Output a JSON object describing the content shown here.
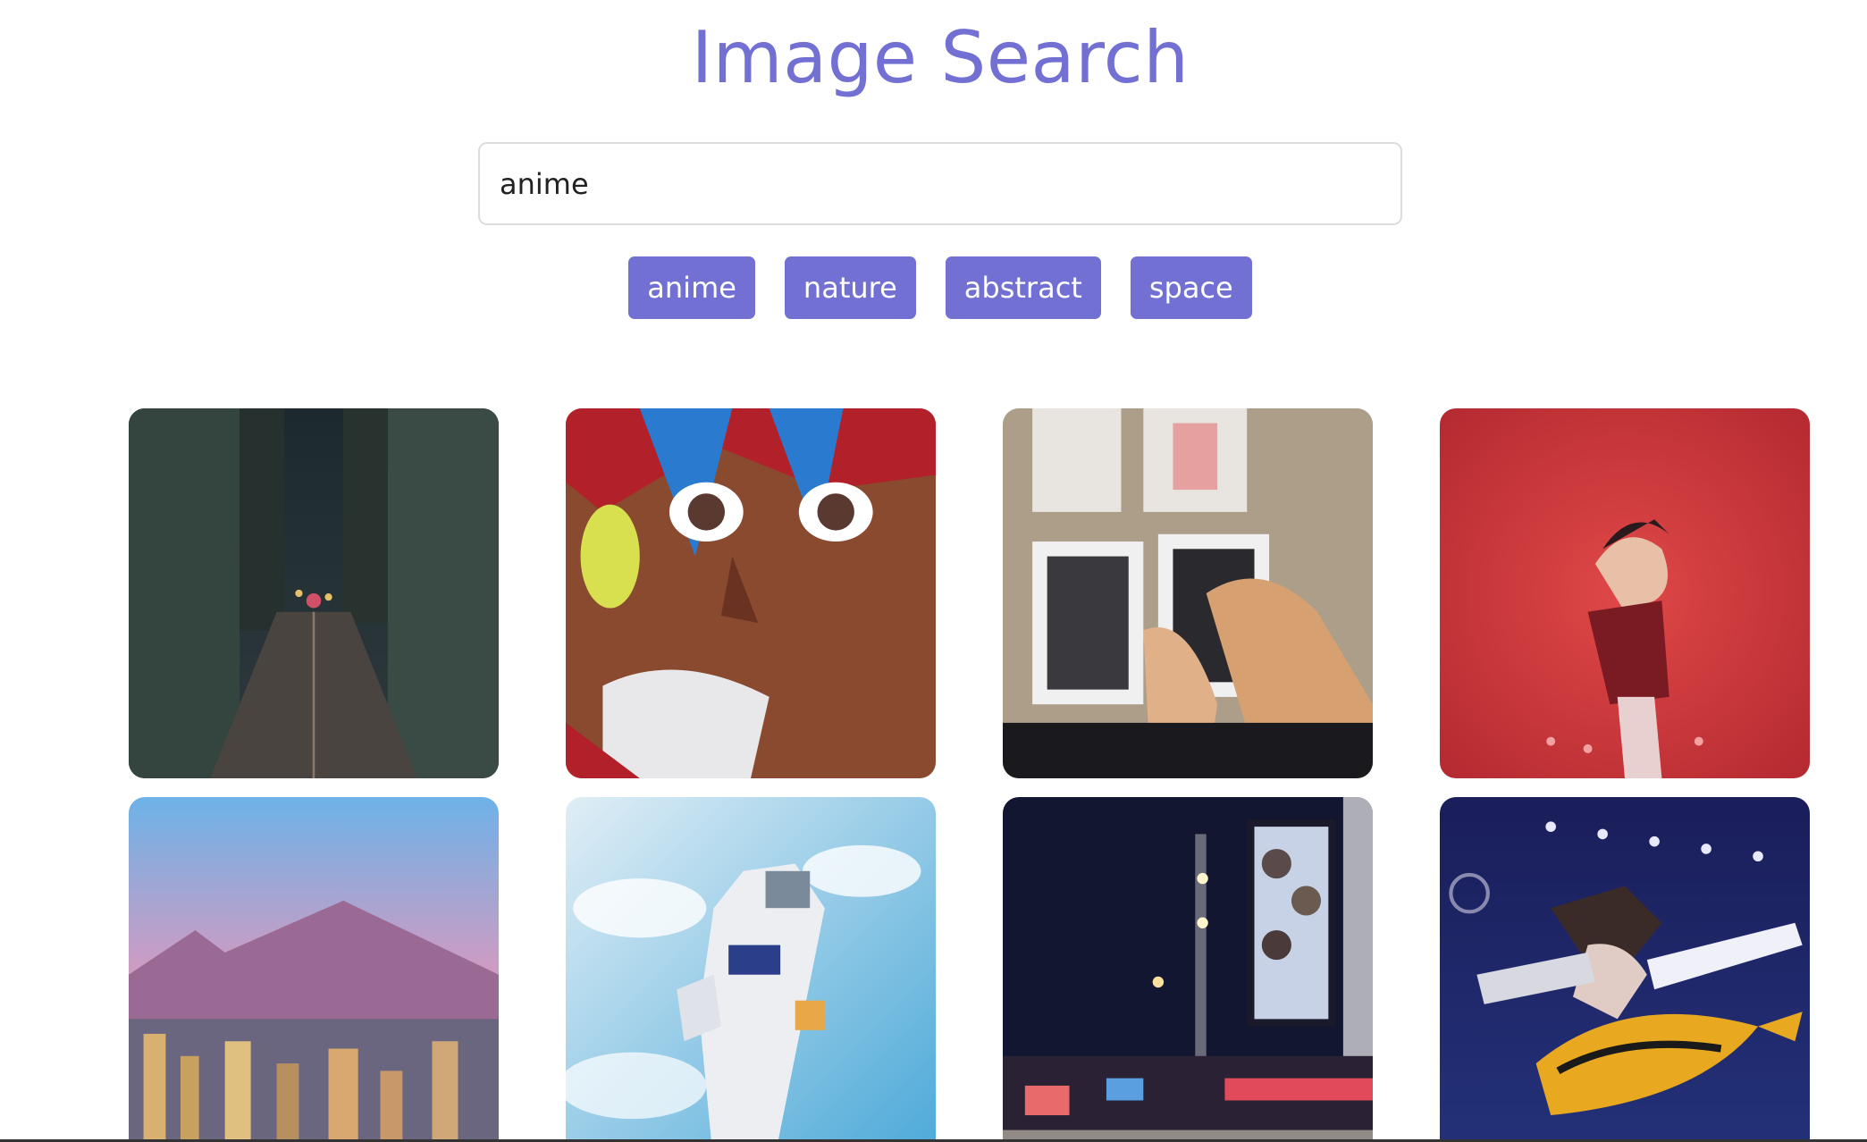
{
  "header": {
    "title": "Image Search"
  },
  "search": {
    "value": "anime",
    "placeholder": ""
  },
  "tags": [
    {
      "label": "anime"
    },
    {
      "label": "nature"
    },
    {
      "label": "abstract"
    },
    {
      "label": "space"
    }
  ],
  "colors": {
    "accent": "#7370d3",
    "background": "#ffffff",
    "input_border": "#dcdcdc"
  },
  "results": [
    {
      "subject": "night-city-street-photo-icon"
    },
    {
      "subject": "anime-graffiti-face-photo-icon"
    },
    {
      "subject": "hands-on-anime-prints-photo-icon"
    },
    {
      "subject": "anime-figure-red-background-photo-icon"
    },
    {
      "subject": "mountain-city-sunset-photo-icon"
    },
    {
      "subject": "robot-statue-sky-photo-icon"
    },
    {
      "subject": "anime-billboard-night-photo-icon"
    },
    {
      "subject": "action-figure-photo-icon"
    }
  ]
}
